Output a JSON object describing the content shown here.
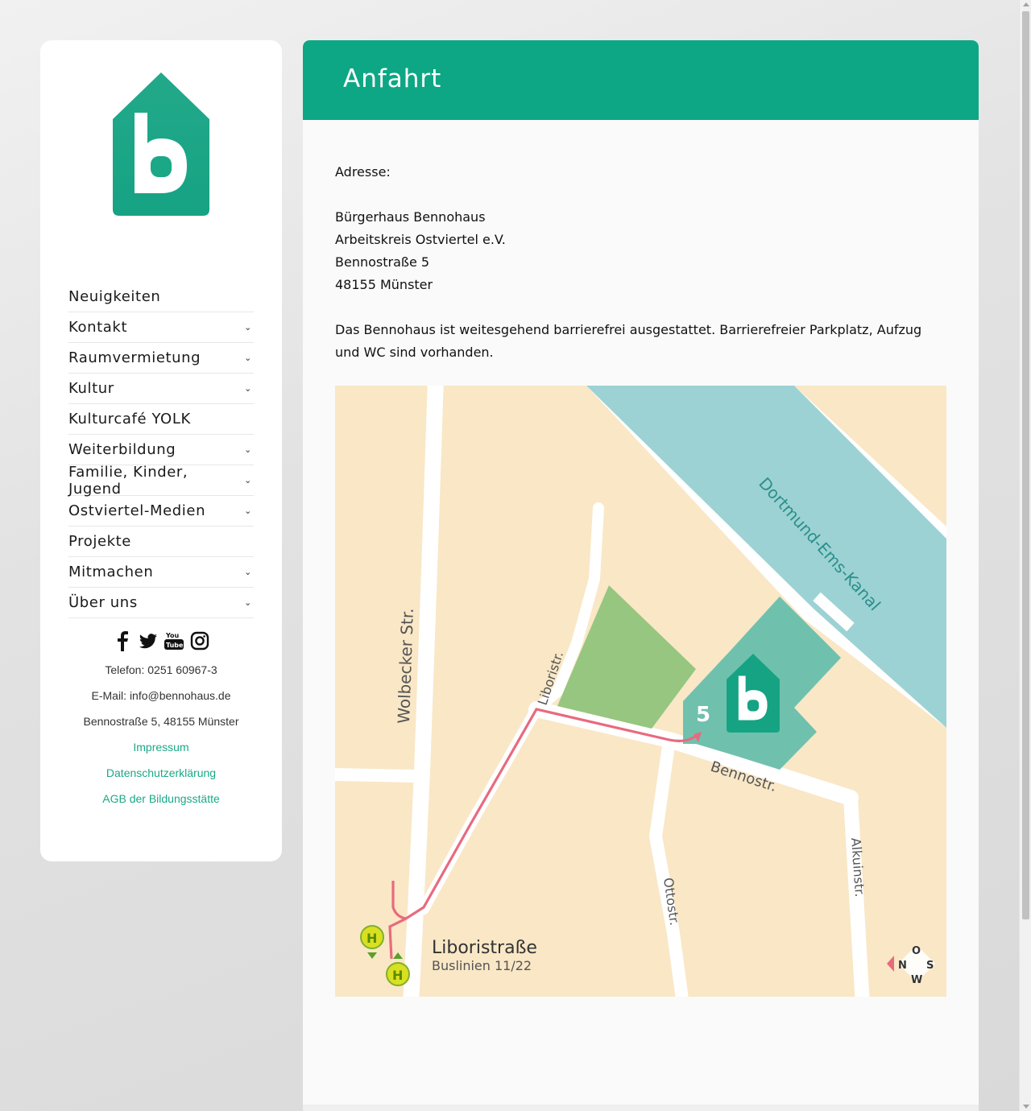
{
  "sidebar": {
    "nav": [
      {
        "label": "Neuigkeiten",
        "has_submenu": false
      },
      {
        "label": "Kontakt",
        "has_submenu": true
      },
      {
        "label": "Raumvermietung",
        "has_submenu": true
      },
      {
        "label": "Kultur",
        "has_submenu": true
      },
      {
        "label": "Kulturcafé YOLK",
        "has_submenu": false
      },
      {
        "label": "Weiterbildung",
        "has_submenu": true
      },
      {
        "label": "Familie, Kinder, Jugend",
        "has_submenu": true
      },
      {
        "label": "Ostviertel-Medien",
        "has_submenu": true
      },
      {
        "label": "Projekte",
        "has_submenu": false
      },
      {
        "label": "Mitmachen",
        "has_submenu": true
      },
      {
        "label": "Über uns",
        "has_submenu": true
      }
    ],
    "chevron": "⌄",
    "social_icons": [
      "facebook-icon",
      "twitter-icon",
      "youtube-icon",
      "instagram-icon"
    ],
    "phone": "Telefon: 0251 60967-3",
    "email": "E-Mail: info@bennohaus.de",
    "address": "Bennostraße 5, 48155 Münster",
    "links": [
      "Impressum",
      "Datenschutzerklärung",
      "AGB der Bildungsstätte"
    ]
  },
  "page": {
    "title": "Anfahrt",
    "address_label": "Adresse:",
    "address_lines": [
      "Bürgerhaus Bennohaus",
      "Arbeitskreis Ostviertel e.V.",
      "Bennostraße 5",
      "48155 Münster"
    ],
    "accessibility_text": "Das Bennohaus ist weitesgehend barrierefrei ausgestattet. Barrierefreier Parkplatz, Aufzug und WC sind vorhanden."
  },
  "map": {
    "streets": {
      "wolbecker": "Wolbecker Str.",
      "liboristr": "Liboristr.",
      "bennostr": "Bennostr.",
      "ottostr": "Ottostr.",
      "alkuinstr": "Alkuinstr."
    },
    "canal": "Dortmund-Ems-Kanal",
    "house_number": "5",
    "bus_stop_name": "Liboristraße",
    "bus_lines": "Buslinien 11/22",
    "bus_symbol": "H",
    "compass": {
      "n": "N",
      "o": "O",
      "s": "S",
      "w": "W"
    },
    "colors": {
      "land": "#f9e7c6",
      "water": "#9cd2d4",
      "park": "#96c67f",
      "building": "#6fc1ae",
      "route": "#e86a7e",
      "stop": "#d9e021"
    }
  },
  "colors": {
    "accent": "#0ea785",
    "logo": "#1ba886",
    "link": "#1ba886"
  }
}
